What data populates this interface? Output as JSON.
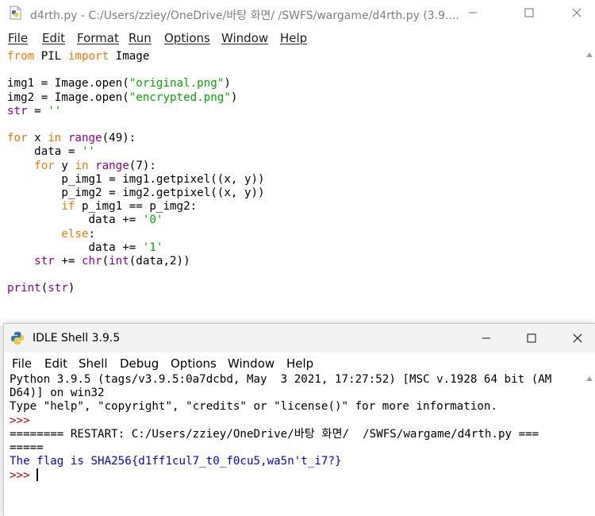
{
  "editor": {
    "title": "d4rth.py - C:/Users/zziey/OneDrive/바탕 화면/   /SWFS/wargame/d4rth.py (3.9....",
    "menu": [
      "File",
      "Edit",
      "Format",
      "Run",
      "Options",
      "Window",
      "Help"
    ],
    "code_lines": [
      [
        {
          "t": "from",
          "c": "kw"
        },
        {
          "t": " PIL "
        },
        {
          "t": "import",
          "c": "kw"
        },
        {
          "t": " Image"
        }
      ],
      [],
      [
        {
          "t": "img1 = Image.open("
        },
        {
          "t": "\"original.png\"",
          "c": "st"
        },
        {
          "t": ")"
        }
      ],
      [
        {
          "t": "img2 = Image.open("
        },
        {
          "t": "\"encrypted.png\"",
          "c": "st"
        },
        {
          "t": ")"
        }
      ],
      [
        {
          "t": "str",
          "c": "bi"
        },
        {
          "t": " = "
        },
        {
          "t": "''",
          "c": "st"
        }
      ],
      [],
      [
        {
          "t": "for",
          "c": "kw"
        },
        {
          "t": " x "
        },
        {
          "t": "in",
          "c": "kw"
        },
        {
          "t": " "
        },
        {
          "t": "range",
          "c": "bi"
        },
        {
          "t": "(49):"
        }
      ],
      [
        {
          "t": "    data = "
        },
        {
          "t": "''",
          "c": "st"
        }
      ],
      [
        {
          "t": "    "
        },
        {
          "t": "for",
          "c": "kw"
        },
        {
          "t": " y "
        },
        {
          "t": "in",
          "c": "kw"
        },
        {
          "t": " "
        },
        {
          "t": "range",
          "c": "bi"
        },
        {
          "t": "(7):"
        }
      ],
      [
        {
          "t": "        p_img1 = img1.getpixel((x, y))"
        }
      ],
      [
        {
          "t": "        p_img2 = img2.getpixel((x, y))"
        }
      ],
      [
        {
          "t": "        "
        },
        {
          "t": "if",
          "c": "kw"
        },
        {
          "t": " p_img1 == p_img2:"
        }
      ],
      [
        {
          "t": "            data += "
        },
        {
          "t": "'0'",
          "c": "st"
        }
      ],
      [
        {
          "t": "        "
        },
        {
          "t": "else",
          "c": "kw"
        },
        {
          "t": ":"
        }
      ],
      [
        {
          "t": "            data += "
        },
        {
          "t": "'1'",
          "c": "st"
        }
      ],
      [
        {
          "t": "    "
        },
        {
          "t": "str",
          "c": "bi"
        },
        {
          "t": " += "
        },
        {
          "t": "chr",
          "c": "bi"
        },
        {
          "t": "("
        },
        {
          "t": "int",
          "c": "bi"
        },
        {
          "t": "(data,2))"
        }
      ],
      [],
      [
        {
          "t": "print",
          "c": "bi"
        },
        {
          "t": "("
        },
        {
          "t": "str",
          "c": "bi"
        },
        {
          "t": ")"
        }
      ]
    ]
  },
  "shell": {
    "title": "IDLE Shell 3.9.5",
    "menu": [
      "File",
      "Edit",
      "Shell",
      "Debug",
      "Options",
      "Window",
      "Help"
    ],
    "lines": [
      [
        {
          "t": "Python 3.9.5 (tags/v3.9.5:0a7dcbd, May  3 2021, 17:27:52) [MSC v.1928 64 bit (AM"
        }
      ],
      [
        {
          "t": "D64)] on win32"
        }
      ],
      [
        {
          "t": "Type \"help\", \"copyright\", \"credits\" or \"license()\" for more information."
        }
      ],
      [
        {
          "t": ">>> ",
          "c": "red"
        }
      ],
      [
        {
          "t": "======== RESTART: C:/Users/zziey/OneDrive/바탕 화면/  /SWFS/wargame/d4rth.py ==="
        }
      ],
      [
        {
          "t": "====="
        }
      ],
      [
        {
          "t": "The flag is SHA256{d1ff1cul7_t0_f0cu5,wa5n't_i7?}",
          "c": "blue"
        }
      ],
      [
        {
          "t": ">>> ",
          "c": "red"
        }
      ]
    ]
  }
}
